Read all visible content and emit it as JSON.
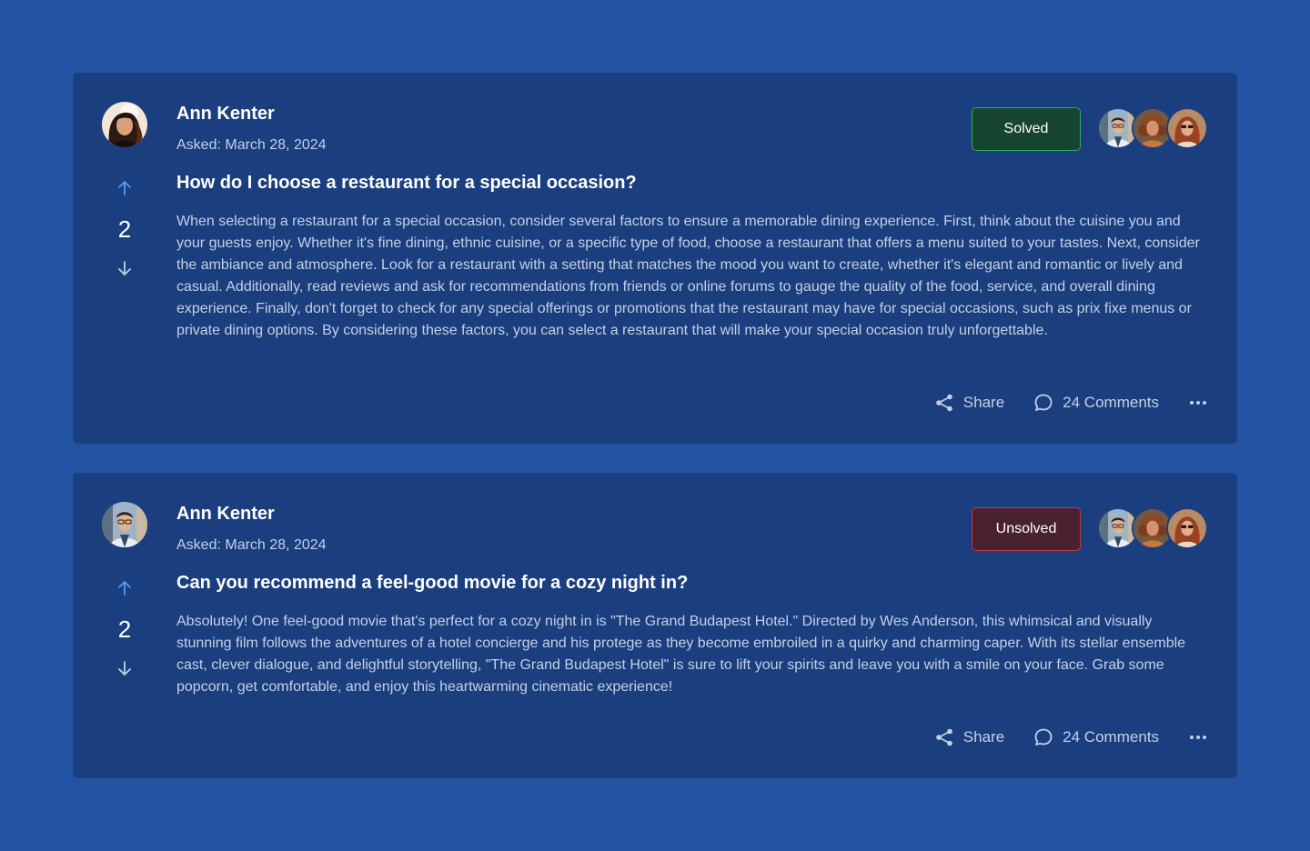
{
  "colors": {
    "page_background": "#2254a3",
    "card_background": "#1b3f7e",
    "vote_arrow": "#4d9bff",
    "solved_border": "#2fa866",
    "unsolved_border": "#c4363f"
  },
  "posts": [
    {
      "author": "Ann Kenter",
      "asked": "Asked: March 28, 2024",
      "title": "How do I choose a restaurant for a special occasion?",
      "body": "When selecting a restaurant for a special occasion, consider several factors to ensure a memorable dining experience. First, think about the cuisine you and your guests enjoy. Whether it's fine dining, ethnic cuisine, or a specific type of food, choose a restaurant that offers a menu suited to your tastes. Next, consider the ambiance and atmosphere. Look for a restaurant with a setting that matches the mood you want to create, whether it's elegant and romantic or lively and casual. Additionally, read reviews and ask for recommendations from friends or online forums to gauge the quality of the food, service, and overall dining experience. Finally, don't forget to check for any special offerings or promotions that the restaurant may have for special occasions, such as prix fixe menus or private dining options. By considering these factors, you can select a restaurant that will make your special occasion truly unforgettable.",
      "votes": "2",
      "status": "Solved",
      "share_label": "Share",
      "comments_label": "24 Comments"
    },
    {
      "author": "Ann Kenter",
      "asked": "Asked: March 28, 2024",
      "title": "Can you recommend a feel-good movie for a cozy night in?",
      "body": "Absolutely! One feel-good movie that's perfect for a cozy night in is \"The Grand Budapest Hotel.\" Directed by Wes Anderson, this whimsical and visually stunning film follows the adventures of a hotel concierge and his protege as they become embroiled in a quirky and charming caper. With its stellar ensemble cast, clever dialogue, and delightful storytelling, \"The Grand Budapest Hotel\" is sure to lift your spirits and leave you with a smile on your face. Grab some popcorn, get comfortable, and enjoy this heartwarming cinematic experience!",
      "votes": "2",
      "status": "Unsolved",
      "share_label": "Share",
      "comments_label": "24 Comments"
    }
  ]
}
